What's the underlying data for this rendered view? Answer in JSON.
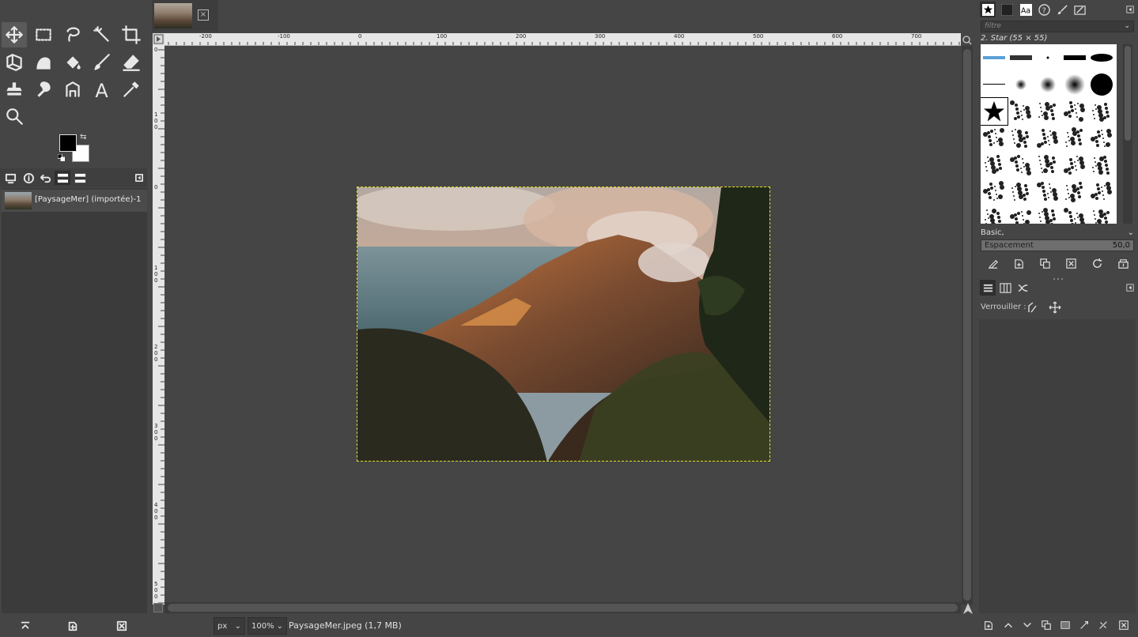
{
  "toolbox": {
    "tools": [
      "move-tool",
      "rect-select-tool",
      "free-select-tool",
      "fuzzy-select-tool",
      "crop-tool",
      "unified-transform-tool",
      "warp-transform-tool",
      "bucket-fill-tool",
      "paintbrush-tool",
      "eraser-tool",
      "clone-tool",
      "smudge-tool",
      "paths-tool",
      "text-tool",
      "color-picker-tool",
      "zoom-tool"
    ],
    "fg_color": "#000000",
    "bg_color": "#ffffff"
  },
  "images_panel": {
    "item_label": "[PaysageMer] (importée)-1"
  },
  "canvas_tab": {
    "close_label": "×"
  },
  "rulers": {
    "h_labels": [
      "-200",
      "-100",
      "0",
      "100",
      "200",
      "300",
      "400",
      "500",
      "600",
      "700"
    ],
    "v_labels": [
      "0",
      "1 0 0",
      "0",
      "1 0 0",
      "2 0 0",
      "3 0 0",
      "4 0 0",
      "5 0 0"
    ]
  },
  "status": {
    "unit": "px",
    "zoom": "100%",
    "text": "PaysageMer.jpeg (1,7 MB)"
  },
  "brushes": {
    "filter_placeholder": "filtre",
    "selected_name": "2. Star (55 × 55)",
    "preset": "Basic,",
    "spacing_label": "Espacement",
    "spacing_value": "50,0"
  },
  "layers": {
    "lock_label": "Verrouiller :"
  },
  "colors": {
    "panel_bg": "#454545",
    "selection_border": "#e0e020"
  }
}
